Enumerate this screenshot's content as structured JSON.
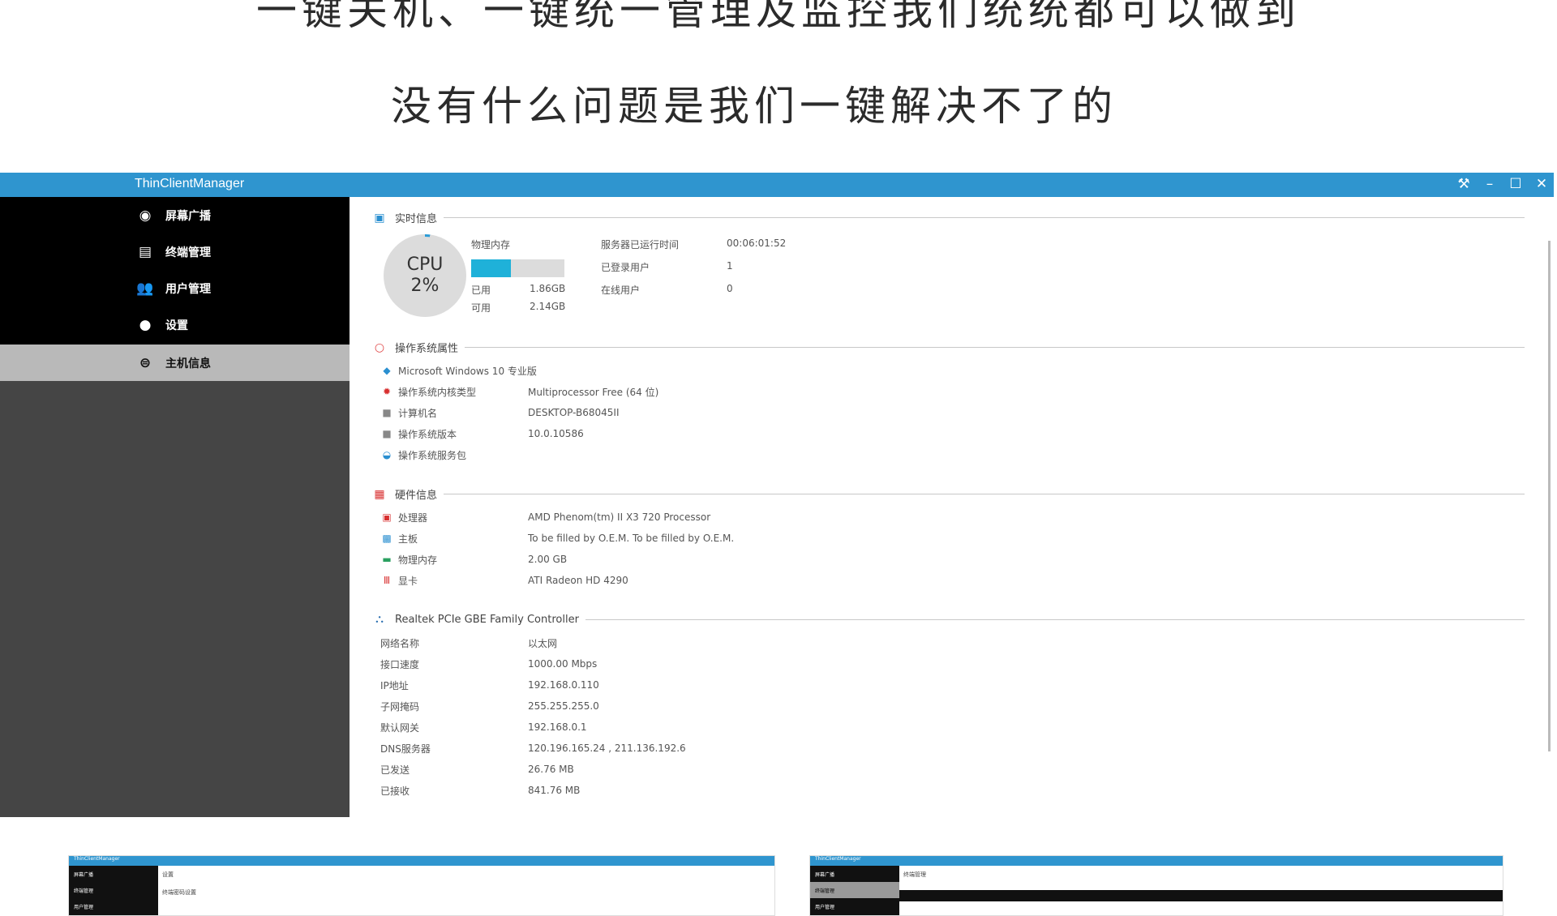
{
  "headline": {
    "line1": "一键关机、一键统一管理及监控我们统统都可以做到",
    "line2": "没有什么问题是我们一键解决不了的"
  },
  "window": {
    "title": "ThinClientManager",
    "controls": [
      "⚒",
      "–",
      "☐",
      "✕"
    ]
  },
  "sidebar": {
    "items": [
      {
        "label": "屏幕广播",
        "icon": "broadcast-icon"
      },
      {
        "label": "终端管理",
        "icon": "terminal-icon"
      },
      {
        "label": "用户管理",
        "icon": "users-icon"
      },
      {
        "label": "设置",
        "icon": "settings-icon"
      },
      {
        "label": "主机信息",
        "icon": "host-icon",
        "active": true
      }
    ]
  },
  "realtime": {
    "section_title": "实时信息",
    "cpu_label": "CPU",
    "cpu_value": "2%",
    "cpu_fraction": 0.02,
    "memory_label": "物理内存",
    "memory_used_fraction": 0.43,
    "used_label": "已用",
    "used_value": "1.86GB",
    "free_label": "可用",
    "free_value": "2.14GB",
    "uptime_label": "服务器已运行时间",
    "uptime_value": "00:06:01:52",
    "connected_label": "已登录用户",
    "connected_value": "1",
    "online_label": "在线用户",
    "online_value": "0"
  },
  "os": {
    "section_title": "操作系统属性",
    "name": "Microsoft Windows 10 专业版",
    "kernel_label": "操作系统内核类型",
    "kernel_value": "Multiprocessor Free (64 位)",
    "computer_label": "计算机名",
    "computer_value": "DESKTOP-B68045II",
    "version_label": "操作系统版本",
    "version_value": "10.0.10586",
    "sp_label": "操作系统服务包"
  },
  "hardware": {
    "section_title": "硬件信息",
    "cpu_label": "处理器",
    "cpu_value": "AMD Phenom(tm) II X3 720 Processor",
    "board_label": "主板",
    "board_value": "To be filled by O.E.M. To be filled by O.E.M.",
    "mem_label": "物理内存",
    "mem_value": "2.00 GB",
    "gpu_label": "显卡",
    "gpu_value": "ATI Radeon HD 4290"
  },
  "network": {
    "section_title": "Realtek PCIe GBE Family Controller",
    "rows": [
      {
        "label": "网络名称",
        "value": "以太网"
      },
      {
        "label": "接口速度",
        "value": "1000.00 Mbps"
      },
      {
        "label": "IP地址",
        "value": "192.168.0.110"
      },
      {
        "label": "子网掩码",
        "value": "255.255.255.0"
      },
      {
        "label": "默认网关",
        "value": "192.168.0.1"
      },
      {
        "label": "DNS服务器",
        "value": "120.196.165.24 , 211.136.192.6"
      },
      {
        "label": "已发送",
        "value": "26.76 MB"
      },
      {
        "label": "已接收",
        "value": "841.76 MB"
      }
    ]
  },
  "thumbnails": [
    {
      "title": "ThinClientManager",
      "items": [
        "屏幕广播",
        "终端管理",
        "用户管理"
      ],
      "content": "设置",
      "content2": "终端密码设置"
    },
    {
      "title": "ThinClientManager",
      "items": [
        "屏幕广播",
        "终端管理",
        "用户管理"
      ],
      "content": "终端管理"
    }
  ]
}
